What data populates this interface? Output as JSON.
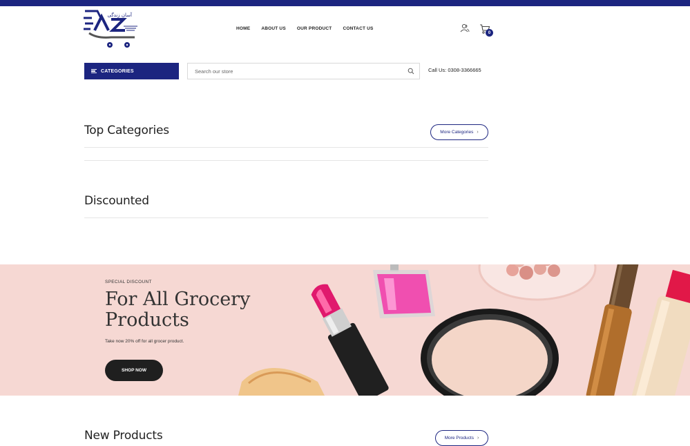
{
  "header": {
    "logo_tagline": "آسان زندگی",
    "nav": [
      "HOME",
      "ABOUT US",
      "OUR PRODUCT",
      "CONTACT US"
    ],
    "cart_count": "0"
  },
  "toolbar": {
    "categories_label": "CATEGORIES",
    "search_placeholder": "Search our store",
    "call_us": "Call Us: 0308-3366665"
  },
  "sections": {
    "top_categories": {
      "title": "Top Categories",
      "more_label": "More Categories"
    },
    "discounted": {
      "title": "Discounted"
    },
    "new_products": {
      "title": "New Products",
      "more_label": "More Products"
    }
  },
  "banner": {
    "eyebrow": "SPECIAL DISCOUNT",
    "headline": "For All Grocery Products",
    "sub": "Take now 20% off for all grocer product.",
    "cta": "SHOP NOW"
  },
  "colors": {
    "brand": "#1c2580",
    "banner_bg": "#f6d8d3",
    "cta_bg": "#1f1f1f"
  }
}
